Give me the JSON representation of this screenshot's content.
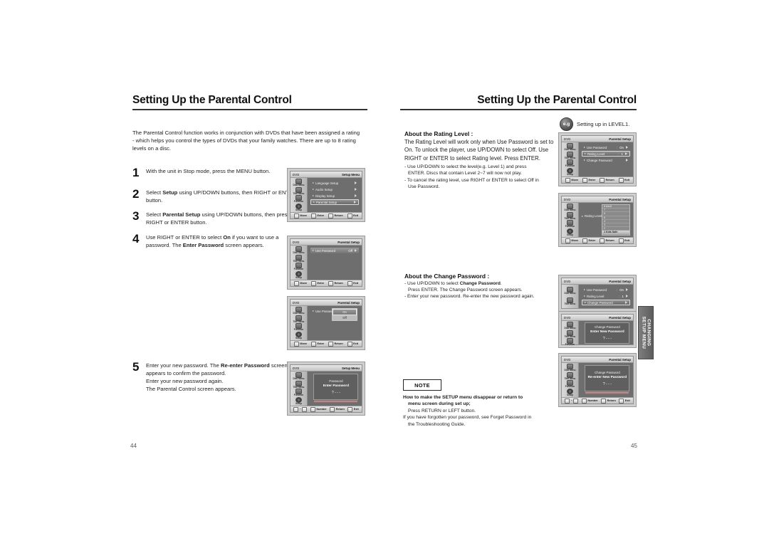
{
  "document": {
    "left_page_number": "44",
    "right_page_number": "45",
    "side_tab": "CHANGING\nSETUP MENU"
  },
  "left_page": {
    "heading": "Setting Up the Parental Control",
    "intro": "The Parental Control function works in conjunction with DVDs that have been assigned a rating - which helps you control the types of DVDs that your family watches. There are up to 8 rating levels on a disc.",
    "steps": [
      {
        "num": "1",
        "text": "With the unit in Stop  mode, press the MENU button."
      },
      {
        "num": "2",
        "text": "Select <b>Setup</b> using UP/DOWN buttons, then RIGHT or ENTER button."
      },
      {
        "num": "3",
        "text": "Select <b>Parental Setup</b> using UP/DOWN buttons, then press the RIGHT or ENTER button."
      },
      {
        "num": "4",
        "text": "Use RIGHT or ENTER to select <b>On</b> if you want to use a password. The <b>Enter Password</b> screen appears."
      },
      {
        "num": "5",
        "text": "Enter your new password. The <b>Re-enter Password</b> screen appears to confirm the password.<br>Enter your new password again.<br>The Parental Control screen appears."
      }
    ]
  },
  "right_page": {
    "heading": "Setting Up the Parental Control",
    "example": {
      "badge": "e.g",
      "text": "Setting up in LEVEL1."
    },
    "rating_section": {
      "title": "About the Rating Level :",
      "body": "The Rating Level will work only when Use Password is set to On. To unlock the player, use UP/DOWN to select Off. Use RIGHT or ENTER to select Rating level. Press ENTER.",
      "bullets": [
        {
          "line1": "- Use UP/DOWN to select the level(e.g. Level 1) and press",
          "line2": "ENTER. Discs that contain Level 2~7 will now not play."
        },
        {
          "line1": "- To cancel the rating level, use RIGHT or ENTER to select Off in",
          "line2": "Use Password."
        }
      ]
    },
    "change_section": {
      "title": "About the Change Password :",
      "bullets": [
        {
          "line1": "- Use UP/DOWN to select <b>Change Password</b>.",
          "line2": "Press ENTER. The Change Password screen appears."
        },
        {
          "line1": "- Enter your new password. Re-enter the new password again.",
          "line2": ""
        }
      ]
    },
    "note": {
      "tag": "NOTE",
      "items": [
        {
          "line1": "<b>How to make the SETUP menu disappear or return to</b>",
          "line2": "<b>menu screen during set up;</b>",
          "line3": "Press RETURN or LEFT button."
        },
        {
          "line1": "If you have forgotten your password, see Forget Password in",
          "line2": "the Troubleshooting Guide.",
          "line3": ""
        }
      ]
    }
  },
  "osd_common": {
    "source_label": "DVD",
    "side_items": [
      {
        "label": "Disc Menu",
        "icon": "disc-icon"
      },
      {
        "label": "Title Menu",
        "icon": "title-icon"
      },
      {
        "label": "Function",
        "icon": "function-icon"
      },
      {
        "label": "Setup",
        "icon": "gear-icon"
      }
    ],
    "bottom_keys": [
      {
        "label": "Move",
        "icon": "updown-key-icon"
      },
      {
        "label": "Enter",
        "icon": "enter-key-icon"
      },
      {
        "label": "Return",
        "icon": "return-key-icon"
      },
      {
        "label": "Exit",
        "icon": "exit-key-icon"
      }
    ],
    "bottom_keys_number": [
      {
        "label": "",
        "icon": "number-range-icon"
      },
      {
        "label": "Number",
        "icon": "number-key-icon"
      },
      {
        "label": "Return",
        "icon": "return-key-icon"
      },
      {
        "label": "Exit",
        "icon": "exit-key-icon"
      }
    ],
    "titles": {
      "setup_menu": "Setup Menu",
      "parental_setup": "Parental Setup"
    }
  },
  "osd_screens": {
    "setup_menu": {
      "title": "Setup Menu",
      "rows": [
        {
          "label": "Language Setup",
          "value": "",
          "selected": false
        },
        {
          "label": "Audio Setup",
          "value": "",
          "selected": false
        },
        {
          "label": "Display Setup",
          "value": "",
          "selected": false
        },
        {
          "label": "Parental Setup",
          "value": "",
          "selected": true
        }
      ]
    },
    "parental_off": {
      "title": "Parental Setup",
      "rows": [
        {
          "label": "Use Password",
          "value": "Off",
          "selected": false
        }
      ]
    },
    "parental_dropdown": {
      "title": "Parental Setup",
      "rows": [
        {
          "label": "Use Password",
          "value": "",
          "selected": true
        }
      ],
      "options": [
        {
          "label": "On",
          "state": "selected"
        },
        {
          "label": "Off",
          "state": "normal"
        }
      ]
    },
    "enter_password": {
      "title": "Setup Menu",
      "dialog": {
        "heading": "Password",
        "prompt": "Enter Password",
        "digits": "? - - -"
      }
    },
    "parental_level1": {
      "title": "Parental Setup",
      "rows": [
        {
          "label": "Use Password",
          "value": "On",
          "selected": false
        },
        {
          "label": "Rating Level",
          "value": "1",
          "selected": true
        },
        {
          "label": "Change Password",
          "value": "",
          "selected": false
        }
      ]
    },
    "rating_list": {
      "title": "Parental Setup",
      "label": "Rating Level",
      "levels": [
        {
          "label": "8 Adult",
          "selected": false
        },
        {
          "label": "7",
          "selected": false
        },
        {
          "label": "6",
          "selected": false
        },
        {
          "label": "5",
          "selected": false
        },
        {
          "label": "4",
          "selected": false
        },
        {
          "label": "3",
          "selected": false
        },
        {
          "label": "2",
          "selected": false
        },
        {
          "label": "1 Kids Safe",
          "selected": true
        }
      ]
    },
    "parental_change": {
      "title": "Parental Setup",
      "rows": [
        {
          "label": "Use Password",
          "value": "On",
          "selected": false
        },
        {
          "label": "Rating Level",
          "value": "1",
          "selected": false
        },
        {
          "label": "Change Password",
          "value": "",
          "selected": true
        }
      ]
    },
    "enter_new_password": {
      "title": "Parental Setup",
      "dialog": {
        "heading": "Change Password",
        "prompt": "Enter New Password",
        "digits": "? - - -"
      }
    },
    "reenter_new_password": {
      "title": "Parental Setup",
      "dialog": {
        "heading": "Change Password",
        "prompt": "Re-enter  New Password",
        "digits": "? - - -"
      }
    }
  }
}
